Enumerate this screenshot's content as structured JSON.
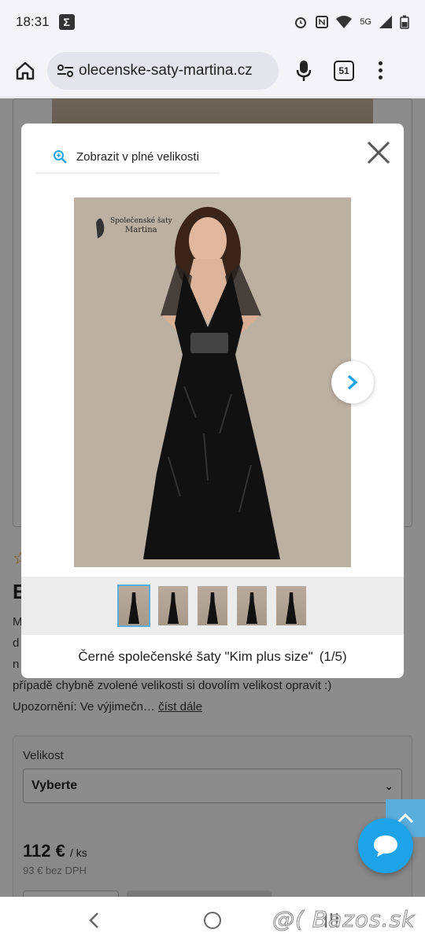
{
  "status_bar": {
    "time": "18:31",
    "network": "5G"
  },
  "browser": {
    "url": "olecenske-saty-martina.cz",
    "tab_count": "51"
  },
  "product_page": {
    "title": "E",
    "description_lines": [
      "M",
      "d",
      "n",
      "případě chybně zvolené velikosti si dovolím velikost opravit :)"
    ],
    "warning": "Upozornění: Ve výjimečn…",
    "more_link": "číst dále",
    "size_label": "Velikost",
    "size_select_value": "Vyberte",
    "price": "112 €",
    "price_unit": "/ ks",
    "price_net": "93 € bez DPH"
  },
  "lightbox": {
    "zoom_label": "Zobrazit v plné velikosti",
    "image_watermark_line1": "Společenské šaty",
    "image_watermark_line2": "Martina",
    "thumbnail_count": 5,
    "active_thumbnail": 1,
    "caption_title": "Černé společenské šaty \"Kim plus size\"",
    "caption_counter": "(1/5)"
  },
  "watermark": "@( Bazos.sk",
  "colors": {
    "accent": "#5aaedb",
    "chat": "#1fa3e8",
    "dress": "#111111",
    "backdrop": "#b9ad9f"
  },
  "icons": {
    "home": "home-icon",
    "tune": "site-settings-icon",
    "mic": "microphone-icon",
    "menu": "more-vert-icon",
    "zoom": "zoom-in-icon",
    "close": "close-icon",
    "next": "chevron-right-icon",
    "chat": "chat-bubble-icon",
    "scroll_top": "chevron-up-icon"
  }
}
